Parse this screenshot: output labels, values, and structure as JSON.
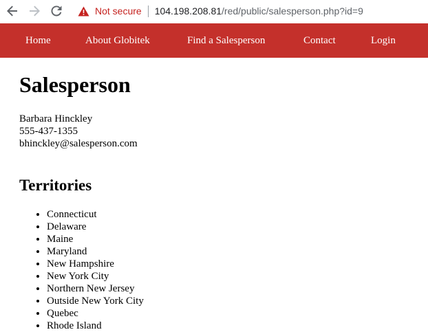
{
  "browser": {
    "security_label": "Not secure",
    "url_host": "104.198.208.81",
    "url_path": "/red/public/salesperson.php?id=9"
  },
  "nav": {
    "items": [
      "Home",
      "About Globitek",
      "Find a Salesperson",
      "Contact",
      "Login"
    ]
  },
  "page": {
    "title": "Salesperson",
    "salesperson": {
      "name": "Barbara Hinckley",
      "phone": "555-437-1355",
      "email": "bhinckley@salesperson.com"
    },
    "territories_heading": "Territories",
    "territories": [
      "Connecticut",
      "Delaware",
      "Maine",
      "Maryland",
      "New Hampshire",
      "New York City",
      "Northern New Jersey",
      "Outside New York City",
      "Quebec",
      "Rhode Island"
    ]
  },
  "colors": {
    "nav_background": "#c4302b",
    "nav_text": "#ffffff",
    "security_warning": "#c5221f"
  },
  "icons": {
    "back": "arrow-left-icon",
    "forward": "arrow-right-icon",
    "reload": "reload-icon",
    "security": "warning-triangle-icon"
  }
}
